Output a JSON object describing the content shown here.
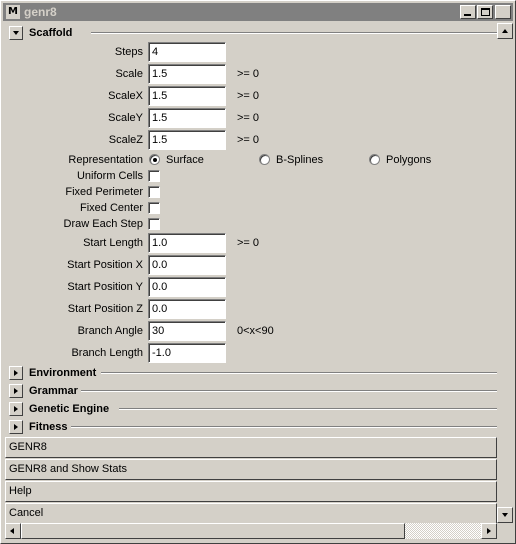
{
  "window": {
    "icon_letter": "M",
    "title": "genr8"
  },
  "frames": {
    "scaffold": "Scaffold",
    "environment": "Environment",
    "grammar": "Grammar",
    "genetic_engine": "Genetic Engine",
    "fitness": "Fitness"
  },
  "fields": {
    "steps": {
      "label": "Steps",
      "value": "4"
    },
    "scale": {
      "label": "Scale",
      "value": "1.5",
      "hint": ">= 0"
    },
    "scale_x": {
      "label": "ScaleX",
      "value": "1.5",
      "hint": ">= 0"
    },
    "scale_y": {
      "label": "ScaleY",
      "value": "1.5",
      "hint": ">= 0"
    },
    "scale_z": {
      "label": "ScaleZ",
      "value": "1.5",
      "hint": ">= 0"
    },
    "start_length": {
      "label": "Start Length",
      "value": "1.0",
      "hint": ">= 0"
    },
    "start_pos_x": {
      "label": "Start Position X",
      "value": "0.0"
    },
    "start_pos_y": {
      "label": "Start Position Y",
      "value": "0.0"
    },
    "start_pos_z": {
      "label": "Start Position Z",
      "value": "0.0"
    },
    "branch_angle": {
      "label": "Branch Angle",
      "value": "30",
      "hint": "0<x<90"
    },
    "branch_length": {
      "label": "Branch Length",
      "value": "-1.0"
    }
  },
  "representation": {
    "label": "Representation",
    "selected": "Surface",
    "options": [
      "Surface",
      "B-Splines",
      "Polygons"
    ]
  },
  "checkboxes": {
    "uniform_cells": {
      "label": "Uniform Cells",
      "checked": false
    },
    "fixed_perimeter": {
      "label": "Fixed Perimeter",
      "checked": false
    },
    "fixed_center": {
      "label": "Fixed Center",
      "checked": false
    },
    "draw_each_step": {
      "label": "Draw Each Step",
      "checked": false
    }
  },
  "buttons": {
    "genr8": "GENR8",
    "genr8_stats": "GENR8 and Show Stats",
    "help": "Help",
    "cancel": "Cancel"
  },
  "colors": {
    "face": "#d4d0c8",
    "titlebar_inactive": "#808080",
    "field_bg": "#ffffff"
  },
  "icons": {
    "window_icon": "maya-icon",
    "minimize": "minimize-icon",
    "maximize": "maximize-icon",
    "close": "close-icon"
  }
}
